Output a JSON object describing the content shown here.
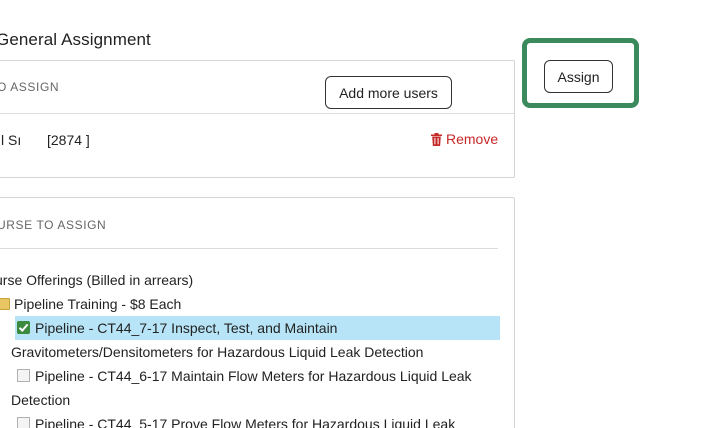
{
  "page": {
    "title": "General Assignment"
  },
  "users_section": {
    "label": "O ASSIGN",
    "add_more_label": "Add more users",
    "user": {
      "name": "l Sı",
      "id": "[2874   ]"
    },
    "remove_label": "Remove"
  },
  "course_section": {
    "label": "URSE TO ASSIGN",
    "root_label": "urse Offerings (Billed in arrears)",
    "folder_label": "Pipeline Training - $8 Each",
    "items": [
      {
        "label": "Pipeline - CT44_7-17 Inspect, Test, and Maintain",
        "continuation": "Gravitometers/Densitometers for Hazardous Liquid Leak Detection",
        "checked": true,
        "selected": true
      },
      {
        "label": "Pipeline - CT44_6-17 Maintain Flow Meters for Hazardous Liquid Leak",
        "continuation": "Detection",
        "checked": false,
        "selected": false
      },
      {
        "label": "Pipeline - CT44_5-17 Prove Flow Meters for Hazardous Liquid Leak",
        "continuation": "",
        "checked": false,
        "selected": false
      }
    ]
  },
  "actions": {
    "assign_label": "Assign"
  },
  "colors": {
    "highlight_border": "#3a8a5e",
    "remove": "#c62828",
    "selected_row": "#b7e4f6",
    "checkbox_checked": "#3c8a3f"
  },
  "icons": {
    "remove": "trash-icon",
    "folder": "folder-icon",
    "checked": "checkbox-checked-icon",
    "unchecked": "checkbox-unchecked-icon"
  }
}
